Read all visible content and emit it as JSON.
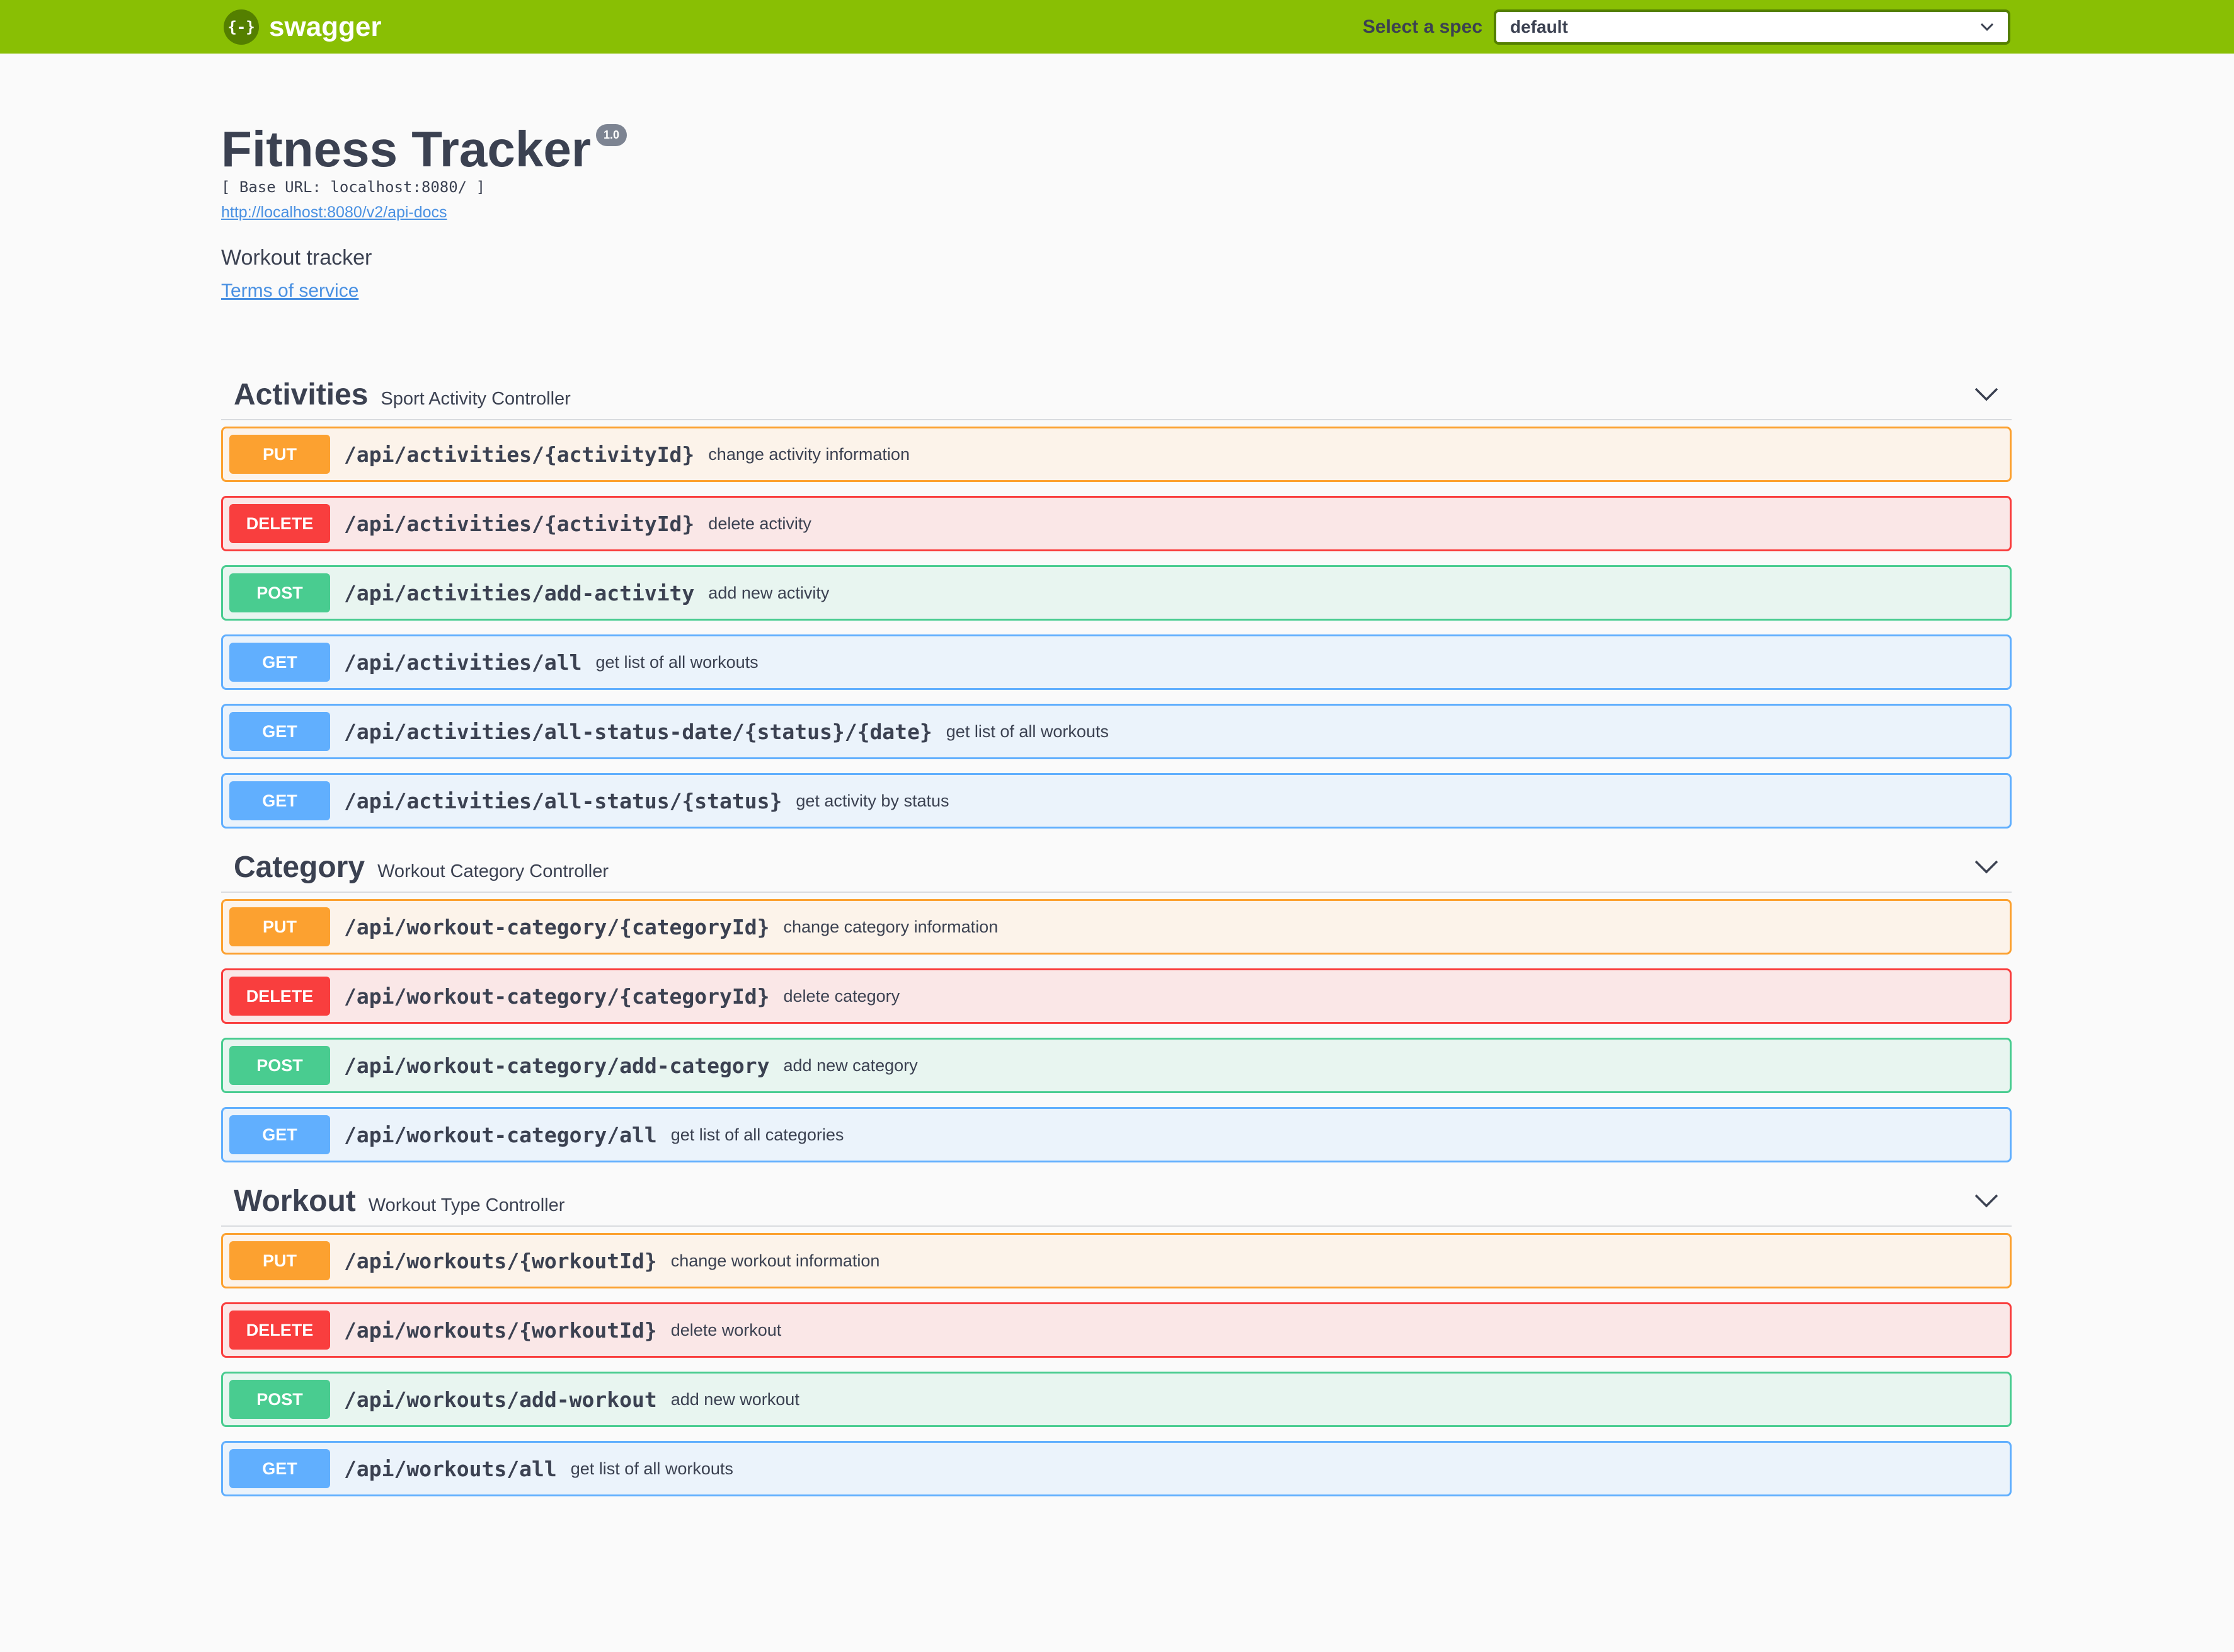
{
  "topbar": {
    "logo_glyph": "{-}",
    "brand": "swagger",
    "spec_label": "Select a spec",
    "spec_value": "default"
  },
  "info": {
    "title": "Fitness Tracker",
    "version": "1.0",
    "base_url": "[ Base URL: localhost:8080/ ]",
    "api_docs_link": "http://localhost:8080/v2/api-docs",
    "description": "Workout tracker",
    "terms": "Terms of service"
  },
  "colors": {
    "put": "#fca130",
    "delete": "#f93e3e",
    "post": "#49cc90",
    "get": "#61affe",
    "topbar": "#89bf04"
  },
  "sections": [
    {
      "name": "Activities",
      "description": "Sport Activity Controller",
      "ops": [
        {
          "method": "PUT",
          "path": "/api/activities/{activityId}",
          "summary": "change activity information"
        },
        {
          "method": "DELETE",
          "path": "/api/activities/{activityId}",
          "summary": "delete activity"
        },
        {
          "method": "POST",
          "path": "/api/activities/add-activity",
          "summary": "add new activity"
        },
        {
          "method": "GET",
          "path": "/api/activities/all",
          "summary": "get list of all workouts"
        },
        {
          "method": "GET",
          "path": "/api/activities/all-status-date/{status}/{date}",
          "summary": "get list of all workouts"
        },
        {
          "method": "GET",
          "path": "/api/activities/all-status/{status}",
          "summary": "get activity by status"
        }
      ]
    },
    {
      "name": "Category",
      "description": "Workout Category Controller",
      "ops": [
        {
          "method": "PUT",
          "path": "/api/workout-category/{categoryId}",
          "summary": "change category information"
        },
        {
          "method": "DELETE",
          "path": "/api/workout-category/{categoryId}",
          "summary": "delete category"
        },
        {
          "method": "POST",
          "path": "/api/workout-category/add-category",
          "summary": "add new category"
        },
        {
          "method": "GET",
          "path": "/api/workout-category/all",
          "summary": "get list of all categories"
        }
      ]
    },
    {
      "name": "Workout",
      "description": "Workout Type Controller",
      "ops": [
        {
          "method": "PUT",
          "path": "/api/workouts/{workoutId}",
          "summary": "change workout information"
        },
        {
          "method": "DELETE",
          "path": "/api/workouts/{workoutId}",
          "summary": "delete workout"
        },
        {
          "method": "POST",
          "path": "/api/workouts/add-workout",
          "summary": "add new workout"
        },
        {
          "method": "GET",
          "path": "/api/workouts/all",
          "summary": "get list of all workouts"
        }
      ]
    }
  ]
}
